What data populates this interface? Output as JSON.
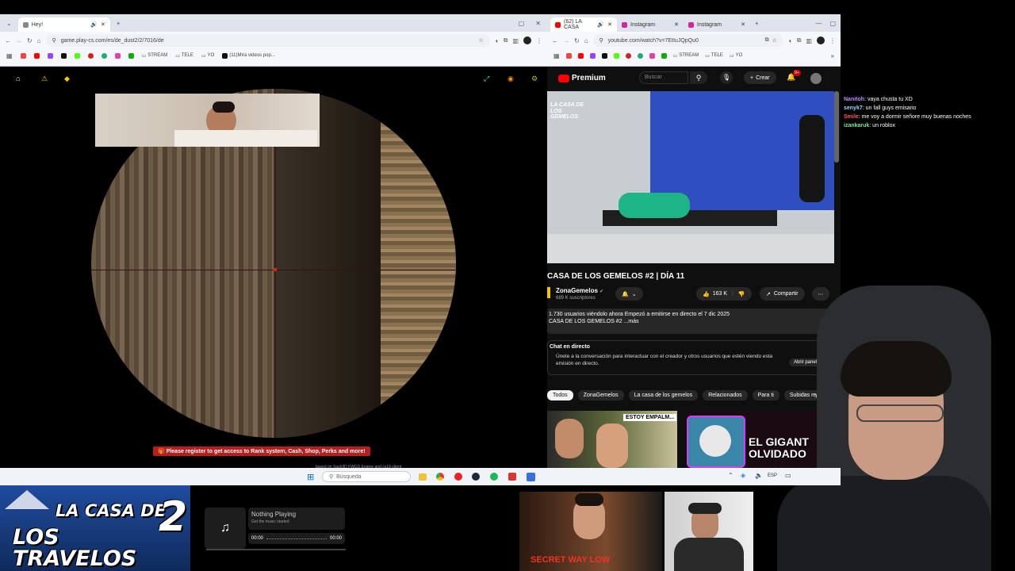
{
  "left_browser": {
    "tab_title": "Hey!",
    "url": "game.play-cs.com/es/de_dust2/2/7016/de",
    "bookmarks": [
      "STREAM",
      "TELE",
      "YO",
      "(11)Mira videos pop..."
    ]
  },
  "game": {
    "register_banner": "Please register to get access to Rank system, Cash, Shop, Perks and more!",
    "footer_text": "based on Xash3D FWGS Engine and cs16-client"
  },
  "right_browser": {
    "tabs": [
      "(62) LA CASA",
      "Instagram",
      "Instagram"
    ],
    "url": "youtube.com/watch?v=7EtIuJQpQu0",
    "bookmarks": [
      "STREAM",
      "TELE",
      "YO"
    ],
    "logo": "Premium",
    "search_placeholder": "Buscar",
    "create_label": "Crear",
    "notification_count": "9+",
    "thumb_overlay_text": "LA CASA DE LOS GEMELOS",
    "video_title": "CASA DE LOS GEMELOS #2 | DÍA 11",
    "channel_name": "ZonaGemelos",
    "subscribers": "689 K suscriptores",
    "likes": "163 K",
    "share_label": "Compartir",
    "viewers_line": "1.730 usuarios viéndolo ahora  Empezó a emitirse en directo el 7 dic 2025",
    "desc_line": "CASA DE LOS GEMELOS #2 ...más",
    "chat_header": "Chat en directo",
    "chat_join_text": "Únete a la conversación para interactuar con el creador y otros usuarios que estén viendo esta emisión en directo.",
    "open_panel": "Abrir panel",
    "chips": [
      "Todos",
      "ZonaGemelos",
      "La casa de los gemelos",
      "Relacionados",
      "Para ti",
      "Subidas recientes"
    ],
    "thumb_1_text": "ESTOY EMPALM...",
    "thumb_2_text": "EL GIGANT OLVIDADO"
  },
  "chat": [
    {
      "user": "Nanitoh",
      "color": "#b98cff",
      "msg": ": vaya chusta tu XD"
    },
    {
      "user": "senyk7",
      "color": "#9ad4ff",
      "msg": ": un fall guys emisario"
    },
    {
      "user": "Smile",
      "color": "#ff5a5a",
      "msg": ": me voy a dormir señore muy buenas noches"
    },
    {
      "user": "izankaruk",
      "color": "#7fe3a0",
      "msg": ": un roblox"
    }
  ],
  "taskbar": {
    "search_placeholder": "Búsqueda",
    "lang": "ESP"
  },
  "stream_logo": {
    "line1": "LA CASA DE",
    "line2": "LOS TRAVELOS",
    "number": "2"
  },
  "music": {
    "title": "Nothing Playing",
    "subtitle": "Get the music started",
    "time_start": "00:00",
    "time_end": "00:00"
  },
  "cam_caption": "SECRET WAY LOW"
}
